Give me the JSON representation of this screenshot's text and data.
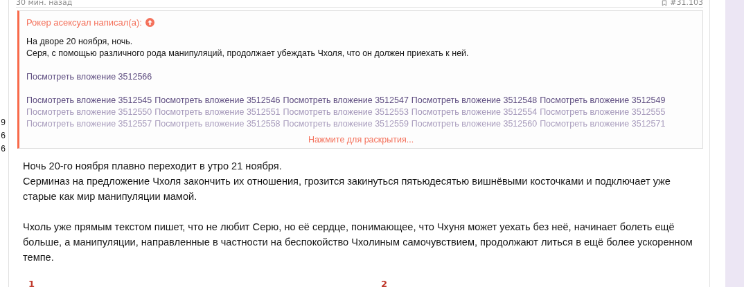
{
  "post_meta": {
    "time": "30 мин. назад",
    "number": "#31.103"
  },
  "side_counts": [
    "9",
    "6",
    "6"
  ],
  "quote": {
    "author": "Рокер асексуал написал(а):",
    "lines": [
      "На дворе 20 ноября, ночь.",
      "Серя, с помощью различного рода манипуляций, продолжает убеждать Чхоля, что он должен приехать к ней."
    ],
    "attachment_rows": [
      [
        "Посмотреть вложение 3512566"
      ],
      [
        "Посмотреть вложение 3512545",
        "Посмотреть вложение 3512546",
        "Посмотреть вложение 3512547",
        "Посмотреть вложение 3512548",
        "Посмотреть вложение 3512549"
      ],
      [
        "Посмотреть вложение 3512550",
        "Посмотреть вложение 3512551",
        "Посмотреть вложение 3512553",
        "Посмотреть вложение 3512554",
        "Посмотреть вложение 3512555"
      ],
      [
        "Посмотреть вложение 3512557",
        "Посмотреть вложение 3512558",
        "Посмотреть вложение 3512559",
        "Посмотреть вложение 3512560",
        "Посмотреть вложение 3512571"
      ]
    ],
    "expand_link": "Нажмите для раскрытия..."
  },
  "body": [
    "Ночь 20-го ноября плавно переходит в утро 21 ноября.\nСерминаз на предложение Чхоля закончить их отношения, грозится закинуться пятьюдесятью вишнёвыми косточками и подключает уже старые как мир манипуляции мамой.",
    "Чхоль уже прямым текстом пишет, что не любит Серю, но её сердце, понимающее, что Чхуня может уехать без неё, начинает болеть ещё больше, а манипуляции, направленные в частности на беспокойство Чхолиным самочувствием, продолжают литься в ещё более ускоренном темпе."
  ],
  "image_markers": [
    "1",
    "2"
  ]
}
